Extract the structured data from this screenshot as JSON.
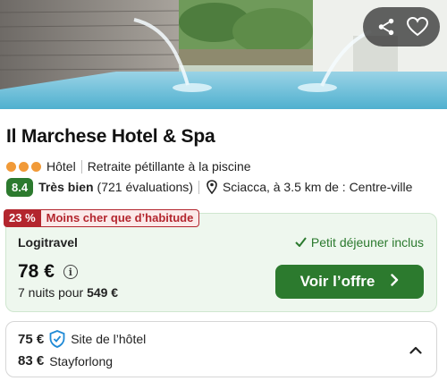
{
  "hotel": {
    "name": "Il Marchese Hotel & Spa",
    "category": "Hôtel",
    "highlight": "Retraite pétillante à la piscine",
    "stars": 3,
    "rating_score": "8.4",
    "rating_label": "Très bien",
    "reviews": "(721 évaluations)",
    "location": "Sciacca, à 3.5 km de : Centre-ville"
  },
  "deal": {
    "discount": "23 %",
    "discount_label": "Moins cher que d’habitude",
    "provider": "Logitravel",
    "amenity": "Petit déjeuner inclus",
    "price": "78 €",
    "nights_text": "7 nuits pour",
    "total": "549 €",
    "cta_label": "Voir l’offre"
  },
  "alternatives": [
    {
      "price": "75 €",
      "source": "Site de l’hôtel",
      "verified": true
    },
    {
      "price": "83 €",
      "source": "Stayforlong",
      "verified": false
    }
  ],
  "icons": {
    "share": "share-icon",
    "favorite": "heart-icon",
    "location": "map-pin-icon",
    "check": "check-icon",
    "info": "info-icon",
    "cta_arrow": "chevron-right-icon",
    "verified": "shield-check-icon",
    "collapse": "chevron-up-icon"
  },
  "colors": {
    "brand_green": "#2c7a2e",
    "discount_red": "#b3262e",
    "star_orange": "#f19a38"
  }
}
